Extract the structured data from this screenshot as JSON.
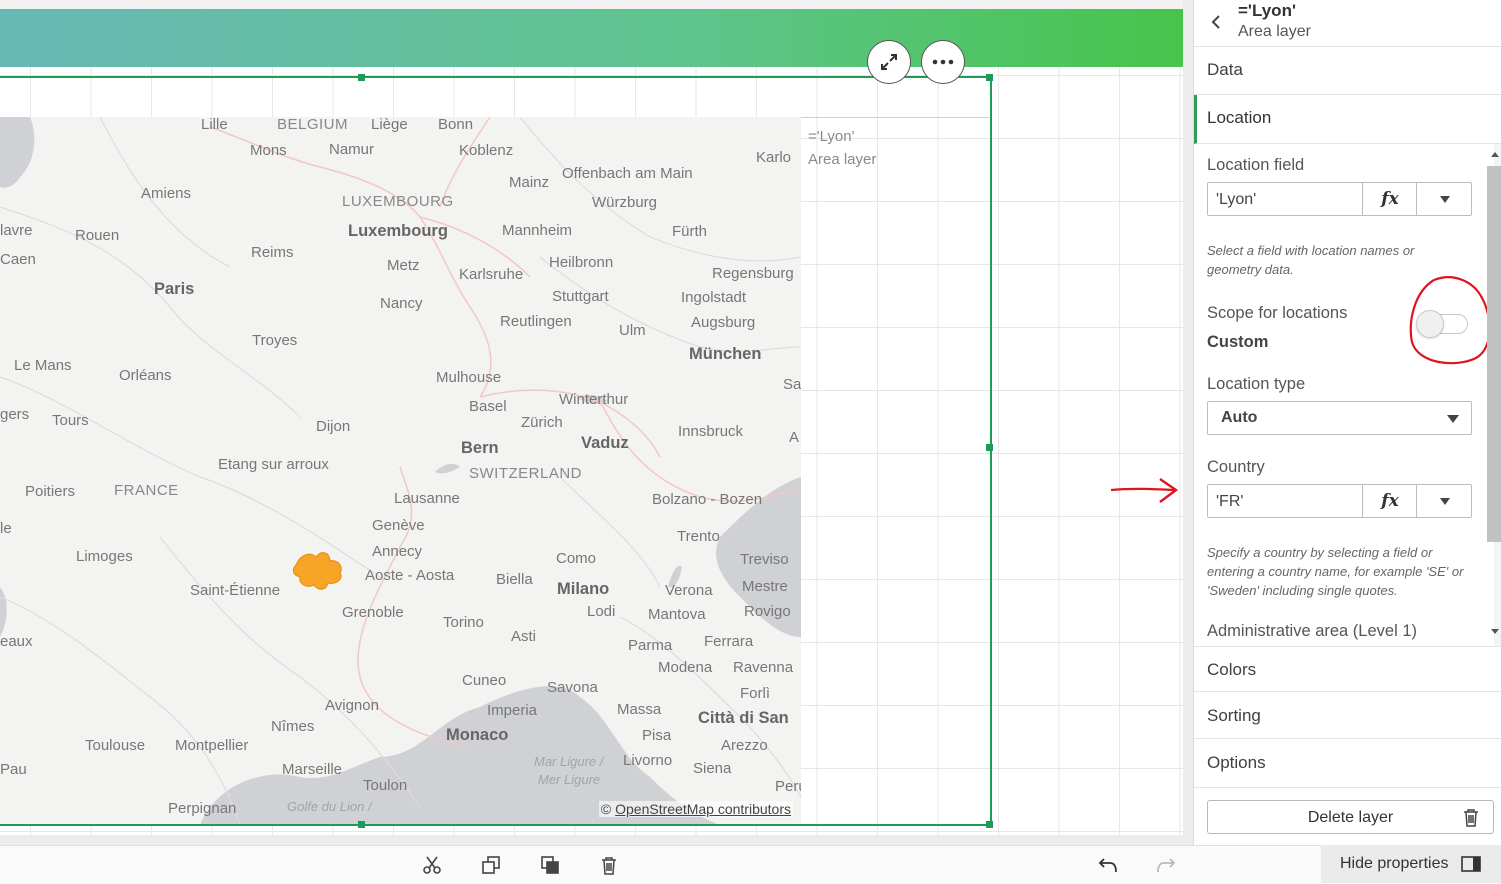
{
  "map": {
    "labels": {
      "lille": "Lille",
      "belgium": "BELGIUM",
      "liege": "Liège",
      "bonn": "Bonn",
      "mons": "Mons",
      "namur": "Namur",
      "koblenz": "Koblenz",
      "amiens": "Amiens",
      "mainz": "Mainz",
      "offenbach": "Offenbach am Main",
      "havre": "lavre",
      "rouen": "Rouen",
      "luxembourg_country": "LUXEMBOURG",
      "wurzburg": "Würzburg",
      "caen": "Caen",
      "luxembourg_city": "Luxembourg",
      "mannheim": "Mannheim",
      "furth": "Fürth",
      "reims": "Reims",
      "heilbronn": "Heilbronn",
      "regensburg": "Regensburg",
      "paris": "Paris",
      "metz": "Metz",
      "karlsruhe": "Karlsruhe",
      "stuttgart": "Stuttgart",
      "ingolstadt": "Ingolstadt",
      "nancy": "Nancy",
      "reutlingen": "Reutlingen",
      "ulm": "Ulm",
      "augsburg": "Augsburg",
      "troyes": "Troyes",
      "munchen": "München",
      "lemans": "Le Mans",
      "orleans": "Orléans",
      "mulhouse": "Mulhouse",
      "basel": "Basel",
      "winterthur": "Winterthur",
      "angers": "gers",
      "tours": "Tours",
      "dijon": "Dijon",
      "zurich": "Zürich",
      "vaduz": "Vaduz",
      "innsbruck": "Innsbruck",
      "bern": "Bern",
      "switzerland": "SWITZERLAND",
      "etang": "Etang sur arroux",
      "poitiers": "Poitiers",
      "france": "FRANCE",
      "lausanne": "Lausanne",
      "bolzano": "Bolzano - Bozen",
      "geneve": "Genève",
      "trento": "Trento",
      "limoges": "Limoges",
      "annecy": "Annecy",
      "como": "Como",
      "treviso": "Treviso",
      "le": "le",
      "aoste": "Aoste - Aosta",
      "biella": "Biella",
      "milano": "Milano",
      "verona": "Verona",
      "mestre": "Mestre",
      "saintetienne": "Saint-Étienne",
      "lodi": "Lodi",
      "rovigo": "Rovigo",
      "grenoble": "Grenoble",
      "mantova": "Mantova",
      "torino": "Torino",
      "ferrara": "Ferrara",
      "bordeaux": "eaux",
      "asti": "Asti",
      "parma": "Parma",
      "modena": "Modena",
      "ravenna": "Ravenna",
      "cuneo": "Cuneo",
      "savona": "Savona",
      "forli": "Forlì",
      "avignon": "Avignon",
      "imperia": "Imperia",
      "massa": "Massa",
      "cittadisan": "Città di San",
      "nimes": "Nîmes",
      "monaco": "Monaco",
      "pisa": "Pisa",
      "arezzo": "Arezzo",
      "toulouse": "Toulouse",
      "montpellier": "Montpellier",
      "marligure": "Mar Ligure /",
      "merligure": "Mer Ligure",
      "livorno": "Livorno",
      "pau": "Pau",
      "marseille": "Marseille",
      "siena": "Siena",
      "toulon": "Toulon",
      "perugia": "Perugi",
      "perpignan": "Perpignan",
      "golfe": "Golfe du Lion /",
      "karlo": "Karlo",
      "sa": "Sa",
      "a": "A"
    },
    "attribution_symbol": "©",
    "attribution_link": "OpenStreetMap contributors",
    "area_fill_color": "#f7a526",
    "water_color": "#cfd1d4"
  },
  "layer_label": {
    "title": "='Lyon'",
    "subtitle": "Area layer"
  },
  "panel": {
    "title": "='Lyon'",
    "subtitle": "Area layer",
    "sections": {
      "data": "Data",
      "location": "Location",
      "colors": "Colors",
      "sorting": "Sorting",
      "options": "Options"
    },
    "location": {
      "field_label": "Location field",
      "field_value": "'Lyon'",
      "field_help": "Select a field with location names or geometry data.",
      "scope_label": "Scope for locations",
      "scope_value": "Custom",
      "type_label": "Location type",
      "type_value": "Auto",
      "country_label": "Country",
      "country_value": "'FR'",
      "country_help": "Specify a country by selecting a field or entering a country name, for example 'SE' or 'Sweden' including single quotes.",
      "admin_label": "Administrative area (Level 1)",
      "fx": "fx"
    },
    "delete_label": "Delete layer"
  },
  "toolbar": {
    "hide_properties": "Hide properties"
  },
  "colors": {
    "accent": "#1e9c55",
    "annotation": "#e0141e"
  }
}
